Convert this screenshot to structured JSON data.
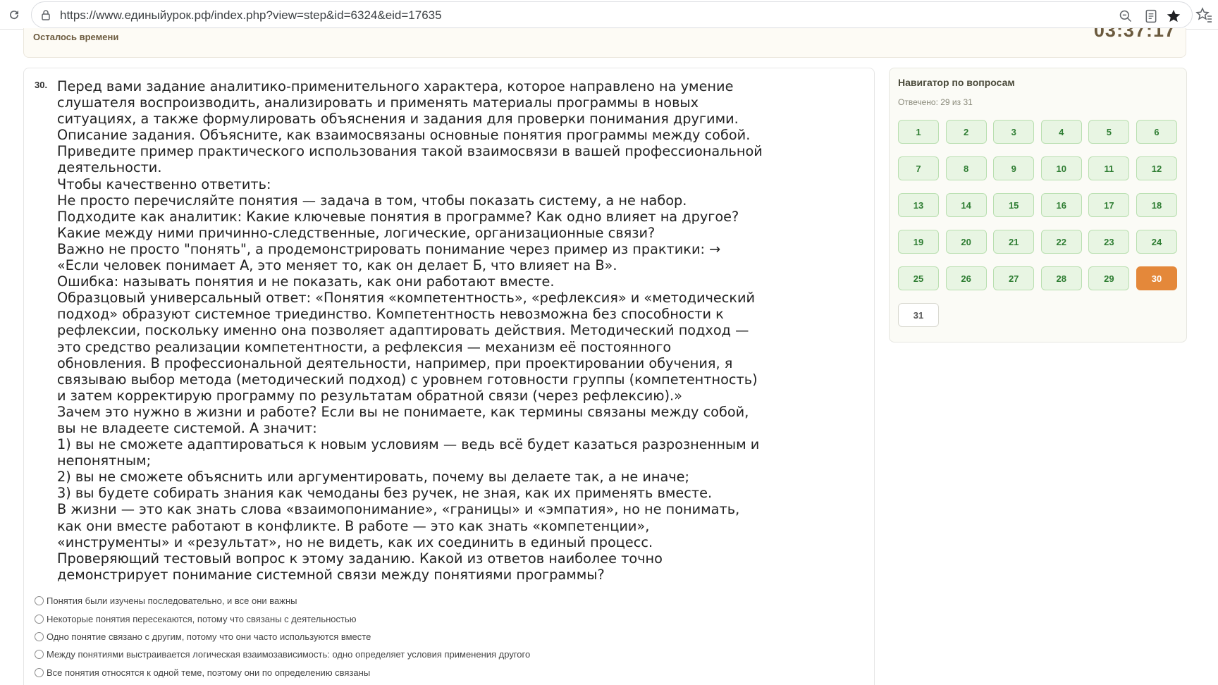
{
  "browser": {
    "url": "https://www.единыйурок.рф/index.php?view=step&id=6324&eid=17635"
  },
  "timer": {
    "label": "Осталось времени",
    "value": "03:37:17"
  },
  "question": {
    "number": "30.",
    "lines": [
      "Перед вами задание аналитико-применительного характера, которое направлено на умение",
      "слушателя воспроизводить, анализировать и применять материалы программы в новых",
      "ситуациях, а также формулировать объяснения и задания для проверки понимания другими.",
      "Описание задания. Объясните, как взаимосвязаны основные понятия программы между собой.",
      "Приведите пример практического использования такой взаимосвязи в вашей профессиональной",
      "деятельности.",
      "Чтобы качественно ответить:",
      "Не просто перечисляйте понятия — задача в том, чтобы показать систему, а не набор.",
      "Подходите как аналитик: Какие ключевые понятия в программе? Как одно влияет на другое?",
      "Какие между ними причинно-следственные, логические, организационные связи?",
      "Важно не просто \"понять\", а продемонстрировать понимание через пример из практики: →",
      "«Если человек понимает А, это меняет то, как он делает Б, что влияет на В».",
      "Ошибка: называть понятия и не показать, как они работают вместе.",
      "Образцовый универсальный ответ: «Понятия «компетентность», «рефлексия» и «методический",
      "подход» образуют системное триединство. Компетентность невозможна без способности к",
      "рефлексии, поскольку именно она позволяет адаптировать действия. Методический подход —",
      "это средство реализации компетентности, а рефлексия — механизм её постоянного",
      "обновления. В профессиональной деятельности, например, при проектировании обучения, я",
      "связываю выбор метода (методический подход) с уровнем готовности группы (компетентность)",
      "и затем корректирую программу по результатам обратной связи (через рефлексию).»",
      "Зачем это нужно в жизни и работе? Если вы не понимаете, как термины связаны между собой,",
      "вы не владеете системой. А значит:",
      "1) вы не сможете адаптироваться к новым условиям — ведь всё будет казаться разрозненным и",
      "непонятным;",
      "2) вы не сможете объяснить или аргументировать, почему вы делаете так, а не иначе;",
      "3) вы будете собирать знания как чемоданы без ручек, не зная, как их применять вместе.",
      "В жизни — это как знать слова «взаимопонимание», «границы» и «эмпатия», но не понимать,",
      "как они вместе работают в конфликте. В работе — это как знать «компетенции»,",
      "«инструменты» и «результат», но не видеть, как их соединить в единый процесс.",
      "Проверяющий тестовый вопрос к этому заданию. Какой из ответов наиболее точно",
      "демонстрирует понимание системной связи между понятиями программы?"
    ],
    "options": [
      "Понятия были изучены последовательно, и все они важны",
      "Некоторые понятия пересекаются, потому что связаны с деятельностью",
      "Одно понятие связано с другим, потому что они часто используются вместе",
      "Между понятиями выстраивается логическая взаимозависимость: одно определяет условия применения другого",
      "Все понятия относятся к одной теме, поэтому они по определению связаны"
    ]
  },
  "navigator": {
    "title": "Навигатор по вопросам",
    "answered": "Отвечено: 29 из 31",
    "current": 30,
    "answered_count": 29,
    "buttons": [
      "1",
      "2",
      "3",
      "4",
      "5",
      "6",
      "7",
      "8",
      "9",
      "10",
      "11",
      "12",
      "13",
      "14",
      "15",
      "16",
      "17",
      "18",
      "19",
      "20",
      "21",
      "22",
      "23",
      "24",
      "25",
      "26",
      "27",
      "28",
      "29",
      "30",
      "31"
    ],
    "colors": {
      "answered": "#e8f5e3",
      "current": "#e4883a",
      "unanswered": "#ffffff"
    }
  }
}
